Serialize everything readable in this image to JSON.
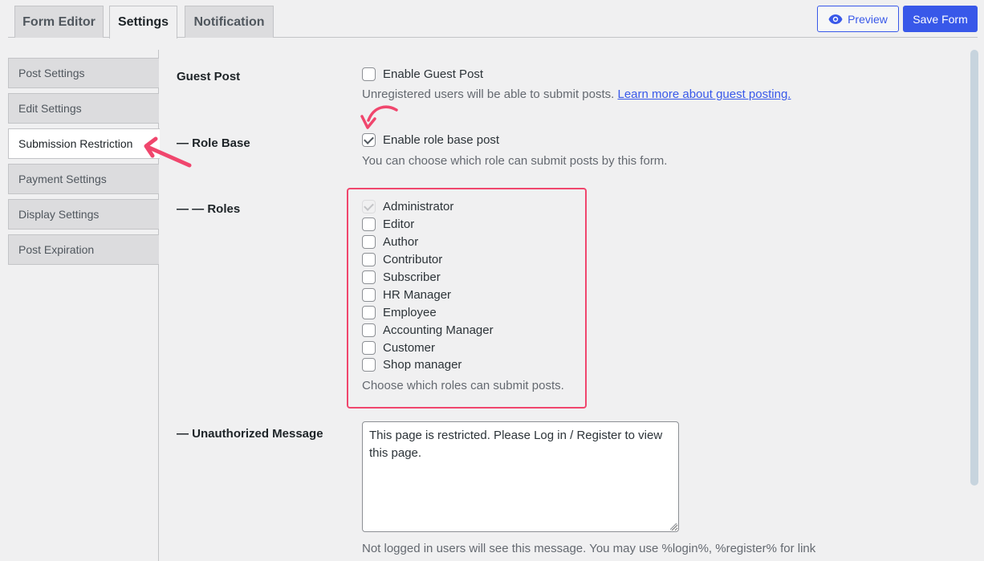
{
  "tabs": [
    {
      "label": "Form Editor",
      "active": false
    },
    {
      "label": "Settings",
      "active": true
    },
    {
      "label": "Notification",
      "active": false
    }
  ],
  "toolbar": {
    "preview_label": "Preview",
    "preview_icon": "eye-icon",
    "save_label": "Save Form",
    "accent_color": "#3858e9"
  },
  "sidebar": {
    "items": [
      {
        "label": "Post Settings",
        "active": false
      },
      {
        "label": "Edit Settings",
        "active": false
      },
      {
        "label": "Submission Restriction",
        "active": true
      },
      {
        "label": "Payment Settings",
        "active": false
      },
      {
        "label": "Display Settings",
        "active": false
      },
      {
        "label": "Post Expiration",
        "active": false
      }
    ]
  },
  "form": {
    "guest_post": {
      "label": "Guest Post",
      "checkbox_label": "Enable Guest Post",
      "checked": false,
      "description": "Unregistered users will be able to submit posts.",
      "link_text": "Learn more about guest posting."
    },
    "role_base": {
      "label": "— Role Base",
      "checkbox_label": "Enable role base post",
      "checked": true,
      "description": "You can choose which role can submit posts by this form."
    },
    "roles": {
      "label": "— — Roles",
      "items": [
        {
          "label": "Administrator",
          "checked": true,
          "disabled": true
        },
        {
          "label": "Editor",
          "checked": false
        },
        {
          "label": "Author",
          "checked": false
        },
        {
          "label": "Contributor",
          "checked": false
        },
        {
          "label": "Subscriber",
          "checked": false
        },
        {
          "label": "HR Manager",
          "checked": false
        },
        {
          "label": "Employee",
          "checked": false
        },
        {
          "label": "Accounting Manager",
          "checked": false
        },
        {
          "label": "Customer",
          "checked": false
        },
        {
          "label": "Shop manager",
          "checked": false
        }
      ],
      "description": "Choose which roles can submit posts."
    },
    "unauthorized_message": {
      "label": "— Unauthorized Message",
      "value": "This page is restricted. Please Log in / Register to view this page.",
      "description": "Not logged in users will see this message. You may use %login%, %register% for link"
    }
  },
  "annotation_color": "#f0466d"
}
